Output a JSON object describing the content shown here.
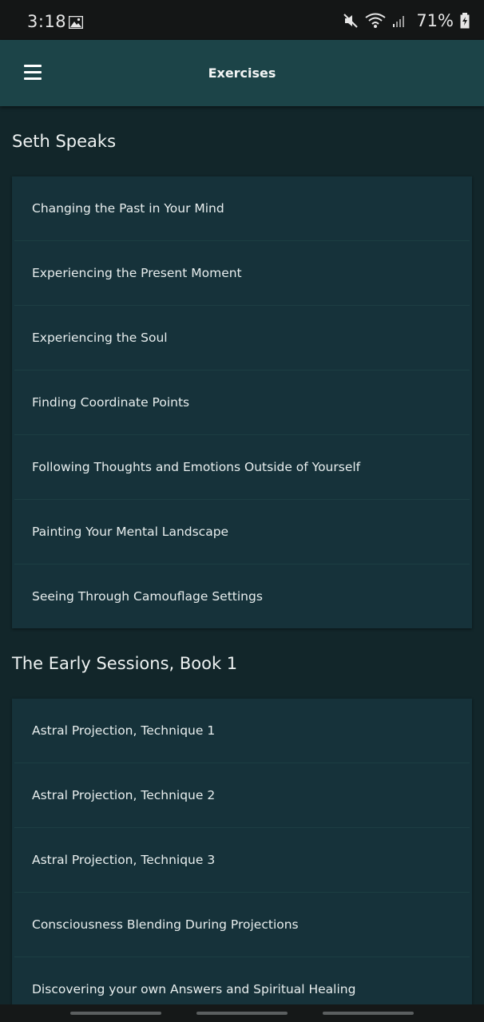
{
  "status_bar": {
    "time": "3:18",
    "battery_percent": "71%",
    "icons": [
      "image-icon",
      "mute-icon",
      "wifi-icon",
      "signal-icon",
      "battery-icon"
    ]
  },
  "app_bar": {
    "title": "Exercises",
    "menu_icon": "hamburger-menu-icon"
  },
  "sections": [
    {
      "title": "Seth Speaks",
      "items": [
        "Changing the Past in Your Mind",
        "Experiencing the Present Moment",
        "Experiencing the Soul",
        "Finding Coordinate Points",
        "Following Thoughts and Emotions Outside of Yourself",
        "Painting Your Mental Landscape",
        "Seeing Through Camouflage Settings"
      ]
    },
    {
      "title": "The Early Sessions, Book 1",
      "items": [
        "Astral Projection, Technique 1",
        "Astral Projection, Technique 2",
        "Astral Projection, Technique 3",
        "Consciousness Blending During Projections",
        "Discovering your own Answers and Spiritual Healing"
      ]
    }
  ],
  "colors": {
    "background": "#12262a",
    "app_bar": "#1c4448",
    "card": "#16323a",
    "status_bar": "#141616"
  }
}
